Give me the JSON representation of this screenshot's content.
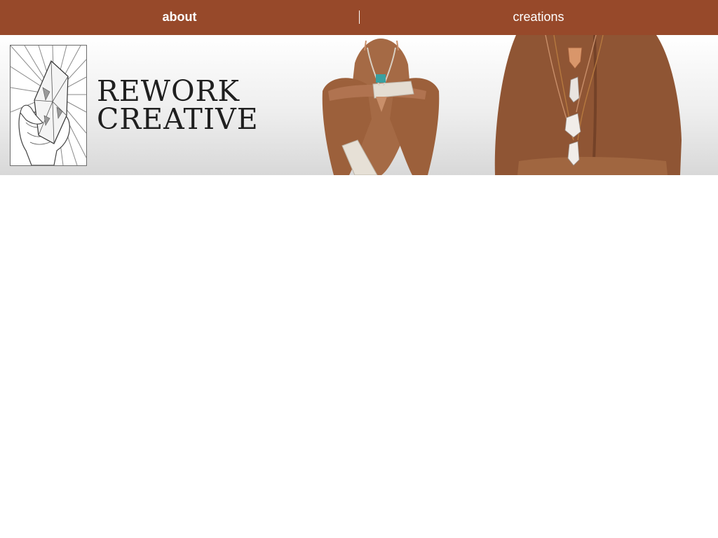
{
  "nav": {
    "items": [
      {
        "label": "about",
        "active": true
      },
      {
        "label": "creations",
        "active": false
      }
    ]
  },
  "brand": {
    "line1": "REWORK",
    "line2": "CREATIVE"
  },
  "banner": {
    "logo_icon": "hand-holding-crystal-icon",
    "photos": [
      "seated-model-with-necklace-photo",
      "model-back-with-crystal-necklaces-photo"
    ]
  },
  "colors": {
    "nav_background": "#97492a",
    "nav_text": "#ffffff",
    "brand_text": "#1f1f1f",
    "skin": "#a0643f"
  }
}
